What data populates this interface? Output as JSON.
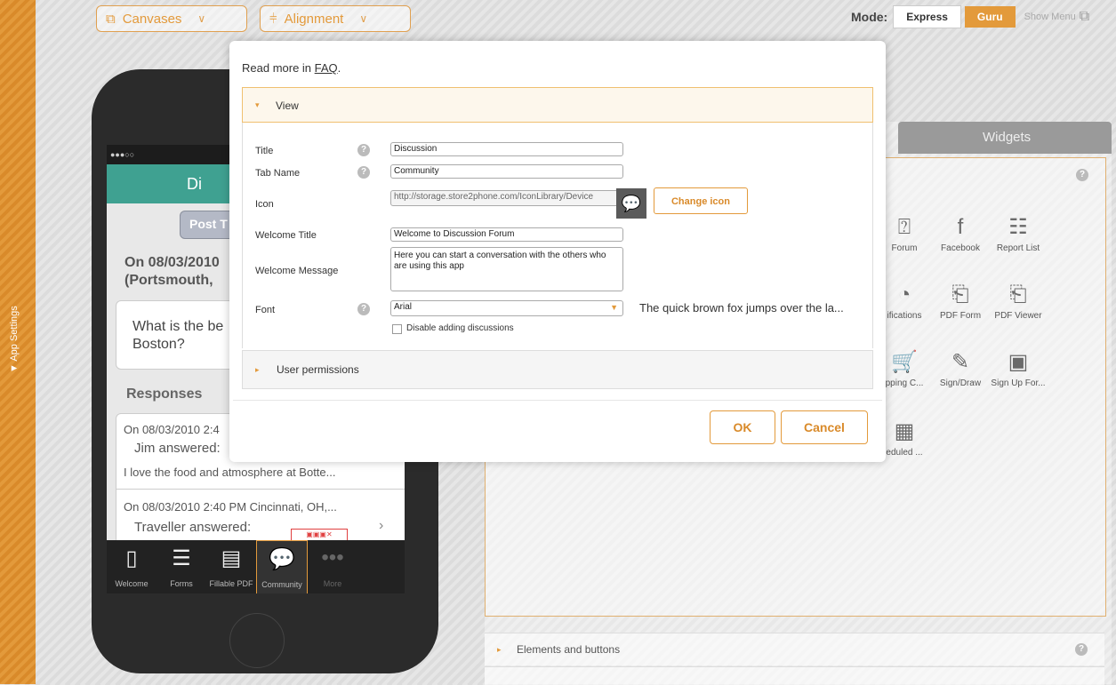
{
  "toolbar": {
    "canvases_label": "Canvases",
    "alignment_label": "Alignment",
    "mode_label": "Mode:",
    "express_label": "Express",
    "guru_label": "Guru",
    "show_menu_label": "Show Menu"
  },
  "sidebar": {
    "app_settings_label": "▼ App Settings"
  },
  "phone": {
    "status": "●●●○○",
    "header_title": "Di",
    "post_button": "Post T",
    "post_date": "On 08/03/2010",
    "post_location": "(Portsmouth,",
    "question": "What is the be",
    "question_line2": "Boston?",
    "responses_heading": "Responses",
    "responses": [
      {
        "date": "On 08/03/2010 2:4",
        "author": "Jim answered:",
        "text": "I love the food and atmosphere at Botte..."
      },
      {
        "date": "On 08/03/2010 2:40 PM  Cincinnati, OH,...",
        "author": "Traveller answered:",
        "text": ""
      }
    ],
    "tabs": [
      {
        "label": "Welcome",
        "icon": "phone-icon"
      },
      {
        "label": "Forms",
        "icon": "list-icon"
      },
      {
        "label": "Fillable PDF",
        "icon": "pdf-icon"
      },
      {
        "label": "Community",
        "icon": "chat-icon"
      },
      {
        "label": "More",
        "icon": "more-icon"
      }
    ]
  },
  "right_panel": {
    "widgets_tab": "Widgets",
    "widgets": [
      {
        "label": "Forum",
        "icon": "question-icon"
      },
      {
        "label": "Facebook",
        "icon": "facebook-icon"
      },
      {
        "label": "Report List",
        "icon": "report-list-icon"
      },
      {
        "label": "ifications",
        "icon": "notification-icon"
      },
      {
        "label": "PDF Form",
        "icon": "pdf-form-icon"
      },
      {
        "label": "PDF Viewer",
        "icon": "pdf-viewer-icon"
      },
      {
        "label": "pping C...",
        "icon": "cart-icon"
      },
      {
        "label": "Sign/Draw",
        "icon": "pencil-icon"
      },
      {
        "label": "Sign Up For...",
        "icon": "signup-icon"
      },
      {
        "label": "eduled ...",
        "icon": "calendar-icon"
      }
    ],
    "elements_and_buttons": "Elements and buttons"
  },
  "dialog": {
    "faq_prefix": "Read more in ",
    "faq_link": "FAQ",
    "faq_suffix": ".",
    "view_section": "View",
    "fields": {
      "title_label": "Title",
      "title_value": "Discussion",
      "tab_name_label": "Tab Name",
      "tab_name_value": "Community",
      "icon_label": "Icon",
      "icon_value": "http://storage.store2phone.com/IconLibrary/Device",
      "change_icon_label": "Change icon",
      "welcome_title_label": "Welcome Title",
      "welcome_title_value": "Welcome to Discussion Forum",
      "welcome_message_label": "Welcome Message",
      "welcome_message_value": "Here you can start a conversation with the others who are using this app",
      "font_label": "Font",
      "font_value": "Arial",
      "font_preview": "The quick brown fox jumps over the la...",
      "disable_label": "Disable adding discussions"
    },
    "user_permissions": "User permissions",
    "ok_label": "OK",
    "cancel_label": "Cancel"
  },
  "colors": {
    "accent": "#e39a3b",
    "phone_header": "#3fa191"
  }
}
